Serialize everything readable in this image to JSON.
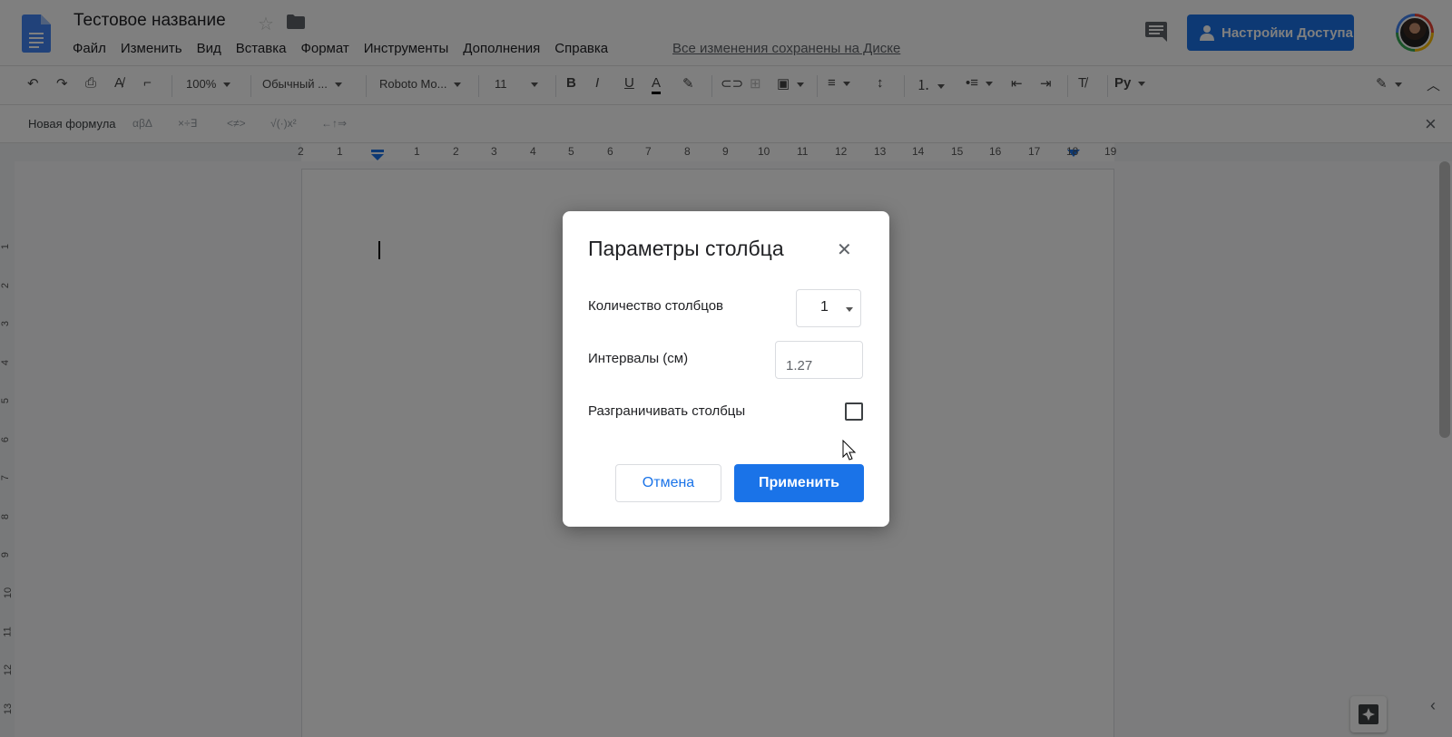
{
  "header": {
    "title": "Тестовое название",
    "menu": [
      "Файл",
      "Изменить",
      "Вид",
      "Вставка",
      "Формат",
      "Инструменты",
      "Дополнения",
      "Справка"
    ],
    "saved_status": "Все изменения сохранены на Диске",
    "share_label": "Настройки Доступа"
  },
  "toolbar": {
    "zoom": "100%",
    "style": "Обычный ...",
    "font": "Roboto Mo...",
    "font_size": "11",
    "lang": "Ру"
  },
  "equation_bar": {
    "new_label": "Новая формула",
    "groups": [
      "αβΔ",
      "×÷∃",
      "<≠>",
      "√(·)x²",
      "←↑⇒"
    ]
  },
  "ruler": {
    "h_numbers": [
      "2",
      "1",
      "1",
      "2",
      "3",
      "4",
      "5",
      "6",
      "7",
      "8",
      "9",
      "10",
      "11",
      "12",
      "13",
      "14",
      "15",
      "16",
      "17",
      "18",
      "19"
    ],
    "v_numbers": [
      "1",
      "2",
      "3",
      "4",
      "5",
      "6",
      "7",
      "8",
      "9",
      "10",
      "11",
      "12",
      "13"
    ]
  },
  "dialog": {
    "title": "Параметры столбца",
    "columns_label": "Количество столбцов",
    "columns_value": "1",
    "spacing_label": "Интервалы (см)",
    "spacing_value": "1.27",
    "line_label": "Разграничивать столбцы",
    "line_checked": false,
    "cancel_label": "Отмена",
    "apply_label": "Применить"
  },
  "colors": {
    "accent": "#1a73e8"
  }
}
